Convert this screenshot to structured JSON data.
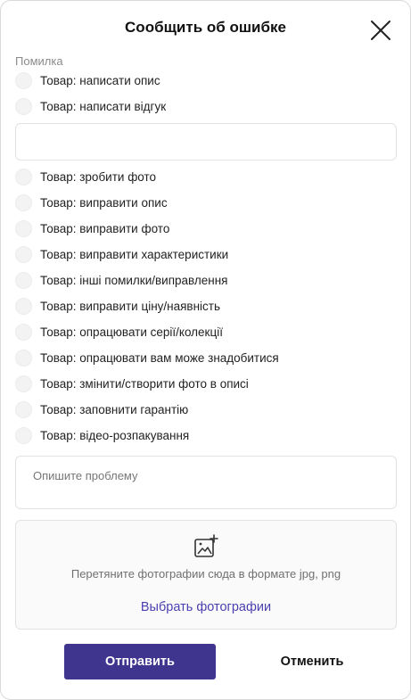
{
  "dialog": {
    "title": "Сообщить об ошибке",
    "close_icon": "close-icon"
  },
  "form": {
    "group_label": "Помилка",
    "options_top": [
      "Товар: написати опис",
      "Товар: написати відгук"
    ],
    "extra_input_value": "",
    "options_bottom": [
      "Товар: зробити фото",
      "Товар: виправити опис",
      "Товар: виправити фото",
      "Товар: виправити характеристики",
      "Товар: інші помилки/виправлення",
      "Товар: виправити ціну/наявність",
      "Товар: опрацювати серії/колекції",
      "Товар: опрацювати вам може знадобитися",
      "Товар: змінити/створити фото в описі",
      "Товар: заповнити гарантію",
      "Товар: відео-розпакування"
    ],
    "description_placeholder": "Опишите проблему",
    "upload": {
      "icon": "add-image-icon",
      "hint": "Перетяните фотографии сюда в формате jpg, png",
      "link_label": "Выбрать фотографии"
    }
  },
  "actions": {
    "submit_label": "Отправить",
    "cancel_label": "Отменить"
  },
  "colors": {
    "primary": "#3f348e",
    "link": "#4b3fb0"
  }
}
